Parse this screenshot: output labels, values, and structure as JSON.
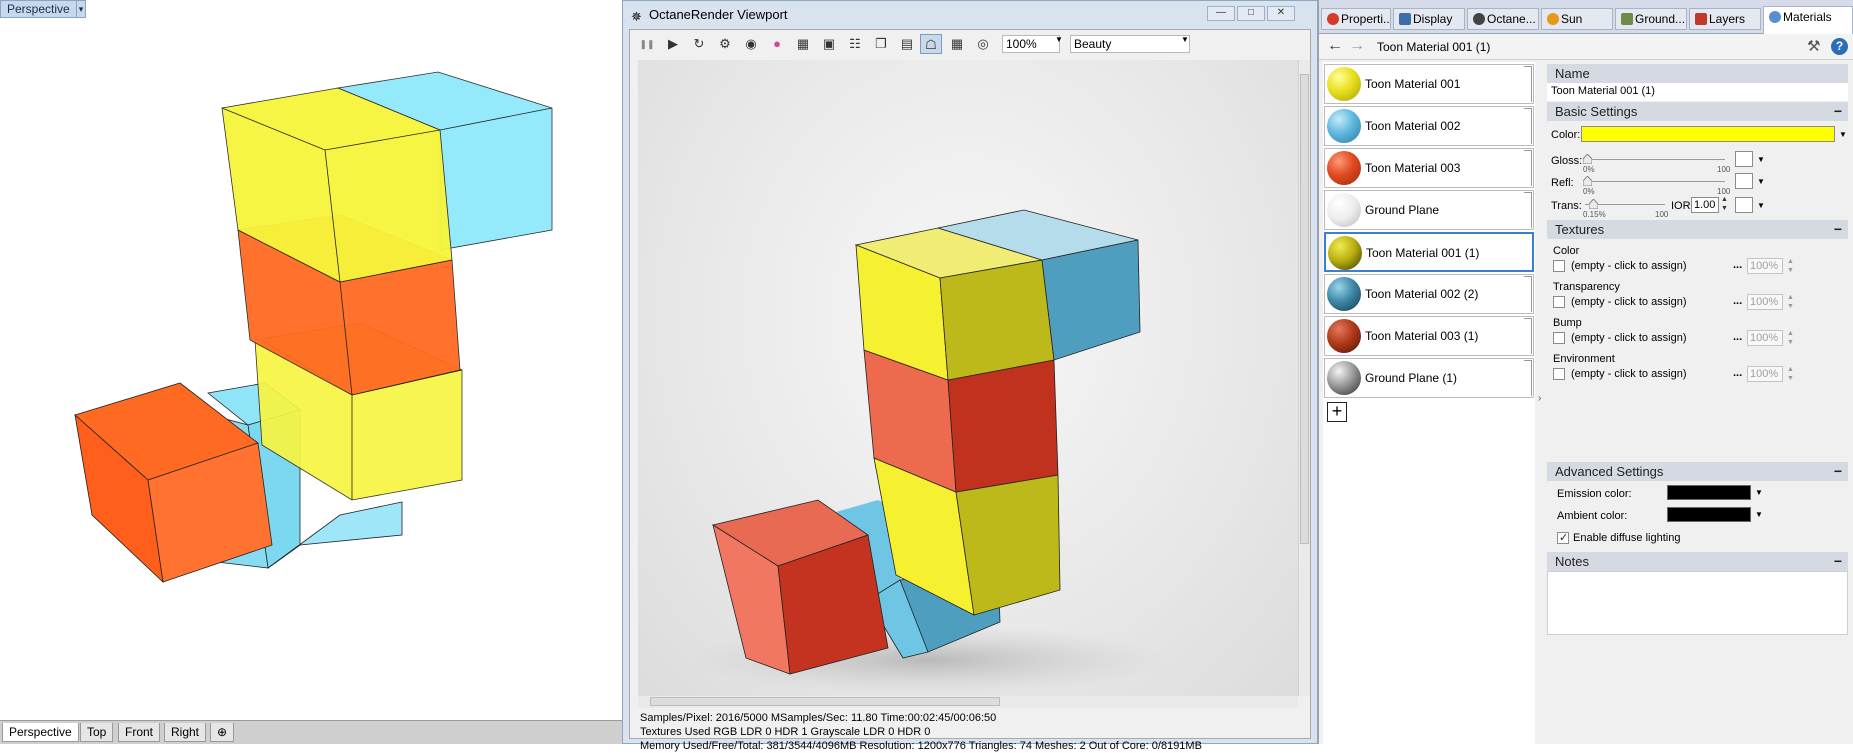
{
  "rhino": {
    "viewport_label": "Perspective",
    "viewport_menu_glyph": "▾",
    "tabs": [
      "Perspective",
      "Top",
      "Front",
      "Right"
    ],
    "add_tab_glyph": "⊕"
  },
  "octane": {
    "title": "OctaneRender Viewport",
    "title_icon": "✵",
    "window_buttons": [
      "—",
      "□",
      "✕"
    ],
    "toolbar_icons": [
      "❚❚",
      "▶",
      "↻",
      "⚙",
      "◉",
      "●",
      "▦",
      "▣",
      "☷",
      "❐",
      "▤",
      "☖",
      "▦",
      "⊕",
      "◎"
    ],
    "zoom": "100%",
    "pass": "Beauty",
    "stats": [
      "Samples/Pixel: 2016/5000  MSamples/Sec: 11.80  Time:00:02:45/00:06:50",
      "Textures Used RGB LDR 0  HDR 1  Grayscale LDR 0  HDR 0",
      "Memory Used/Free/Total: 381/3544/4096MB  Resolution: 1200x776  Triangles: 74  Meshes: 2 Out of Core: 0/8191MB"
    ]
  },
  "panel": {
    "tabs": [
      {
        "label": "Properti...",
        "icon_color": "#d43b2a"
      },
      {
        "label": "Display",
        "icon_color": "#3d6ea8"
      },
      {
        "label": "Octane...",
        "icon_color": "#444444"
      },
      {
        "label": "Sun",
        "icon_color": "#e59a19"
      },
      {
        "label": "Ground...",
        "icon_color": "#6d8b4a"
      },
      {
        "label": "Layers",
        "icon_color": "#c0392b"
      },
      {
        "label": "Materials",
        "icon_color": "#5a8fcf"
      }
    ],
    "breadcrumb": "Toon Material 001 (1)",
    "nav_back": "←",
    "nav_forward": "→",
    "wrench_glyph": "⚒",
    "help_glyph": "?"
  },
  "materials": {
    "items": [
      {
        "label": "Toon Material 001",
        "color": "#e8df1e"
      },
      {
        "label": "Toon Material 002",
        "color": "#5fb8de"
      },
      {
        "label": "Toon Material 003",
        "color": "#e0491f"
      },
      {
        "label": "Ground Plane",
        "color": "#e8e8e8"
      },
      {
        "label": "Toon Material 001 (1)",
        "color": "#b9b010"
      },
      {
        "label": "Toon Material 002 (2)",
        "color": "#3f88a8"
      },
      {
        "label": "Toon Material 003 (1)",
        "color": "#b2391a"
      },
      {
        "label": "Ground Plane (1)",
        "color": "#9a9a9a"
      }
    ],
    "selected_index": 4,
    "add_glyph": "+",
    "splitter_glyph": "›"
  },
  "properties": {
    "name_header": "Name",
    "name_value": "Toon Material 001 (1)",
    "basic_header": "Basic Settings",
    "collapse_glyph": "−",
    "color_label": "Color:",
    "color_value": "#ffff00",
    "gloss_label": "Gloss:",
    "gloss_min": "0%",
    "gloss_max": "100",
    "refl_label": "Refl:",
    "refl_min": "0%",
    "refl_max": "100",
    "trans_label": "Trans:",
    "trans_min": "0.15%",
    "trans_max": "100",
    "ior_label": "IOR:",
    "ior_value": "1.00",
    "textures_header": "Textures",
    "textures": [
      {
        "label": "Color",
        "value": "(empty - click to assign)",
        "pct": "100%"
      },
      {
        "label": "Transparency",
        "value": "(empty - click to assign)",
        "pct": "100%"
      },
      {
        "label": "Bump",
        "value": "(empty - click to assign)",
        "pct": "100%"
      },
      {
        "label": "Environment",
        "value": "(empty - click to assign)",
        "pct": "100%"
      }
    ],
    "dots_glyph": "...",
    "advanced_header": "Advanced Settings",
    "emission_label": "Emission color:",
    "emission_value": "#000000",
    "ambient_label": "Ambient color:",
    "ambient_value": "#000000",
    "diffuse_label": "Enable diffuse lighting",
    "diffuse_checked": true,
    "notes_header": "Notes"
  }
}
